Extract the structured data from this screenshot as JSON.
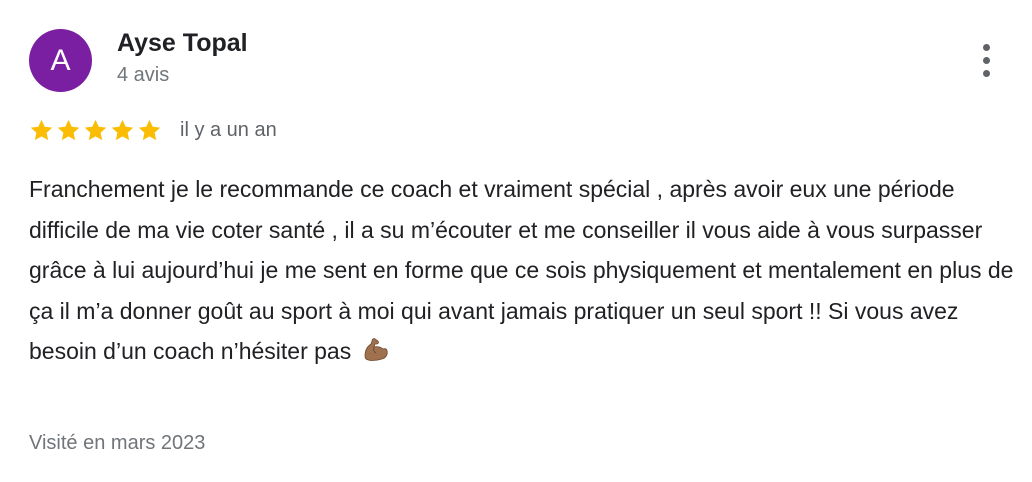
{
  "reviewer": {
    "initial": "A",
    "name": "Ayse Topal",
    "review_count": "4 avis",
    "avatar_color": "#7b1fa2"
  },
  "rating": {
    "stars": 5,
    "max_stars": 5,
    "star_color": "#fbbc04",
    "relative_date": "il y a un an"
  },
  "review": {
    "text": "Franchement je le recommande ce coach et vraiment spécial , après avoir eux une période difficile de ma vie coter santé , il a su m’écouter et me conseiller il vous aide à vous surpasser grâce à lui aujourd’hui je me sent en forme que ce sois physiquement et mentalement en plus de ça il m’a donner goût au sport à moi qui avant jamais pratiquer un seul sport !! Si vous avez besoin d’un coach n’hésiter pas",
    "trailing_emoji": "flexed-biceps-emoji"
  },
  "visit": {
    "label": "Visité en mars 2023"
  },
  "menu": {
    "icon": "more-vertical-icon"
  }
}
